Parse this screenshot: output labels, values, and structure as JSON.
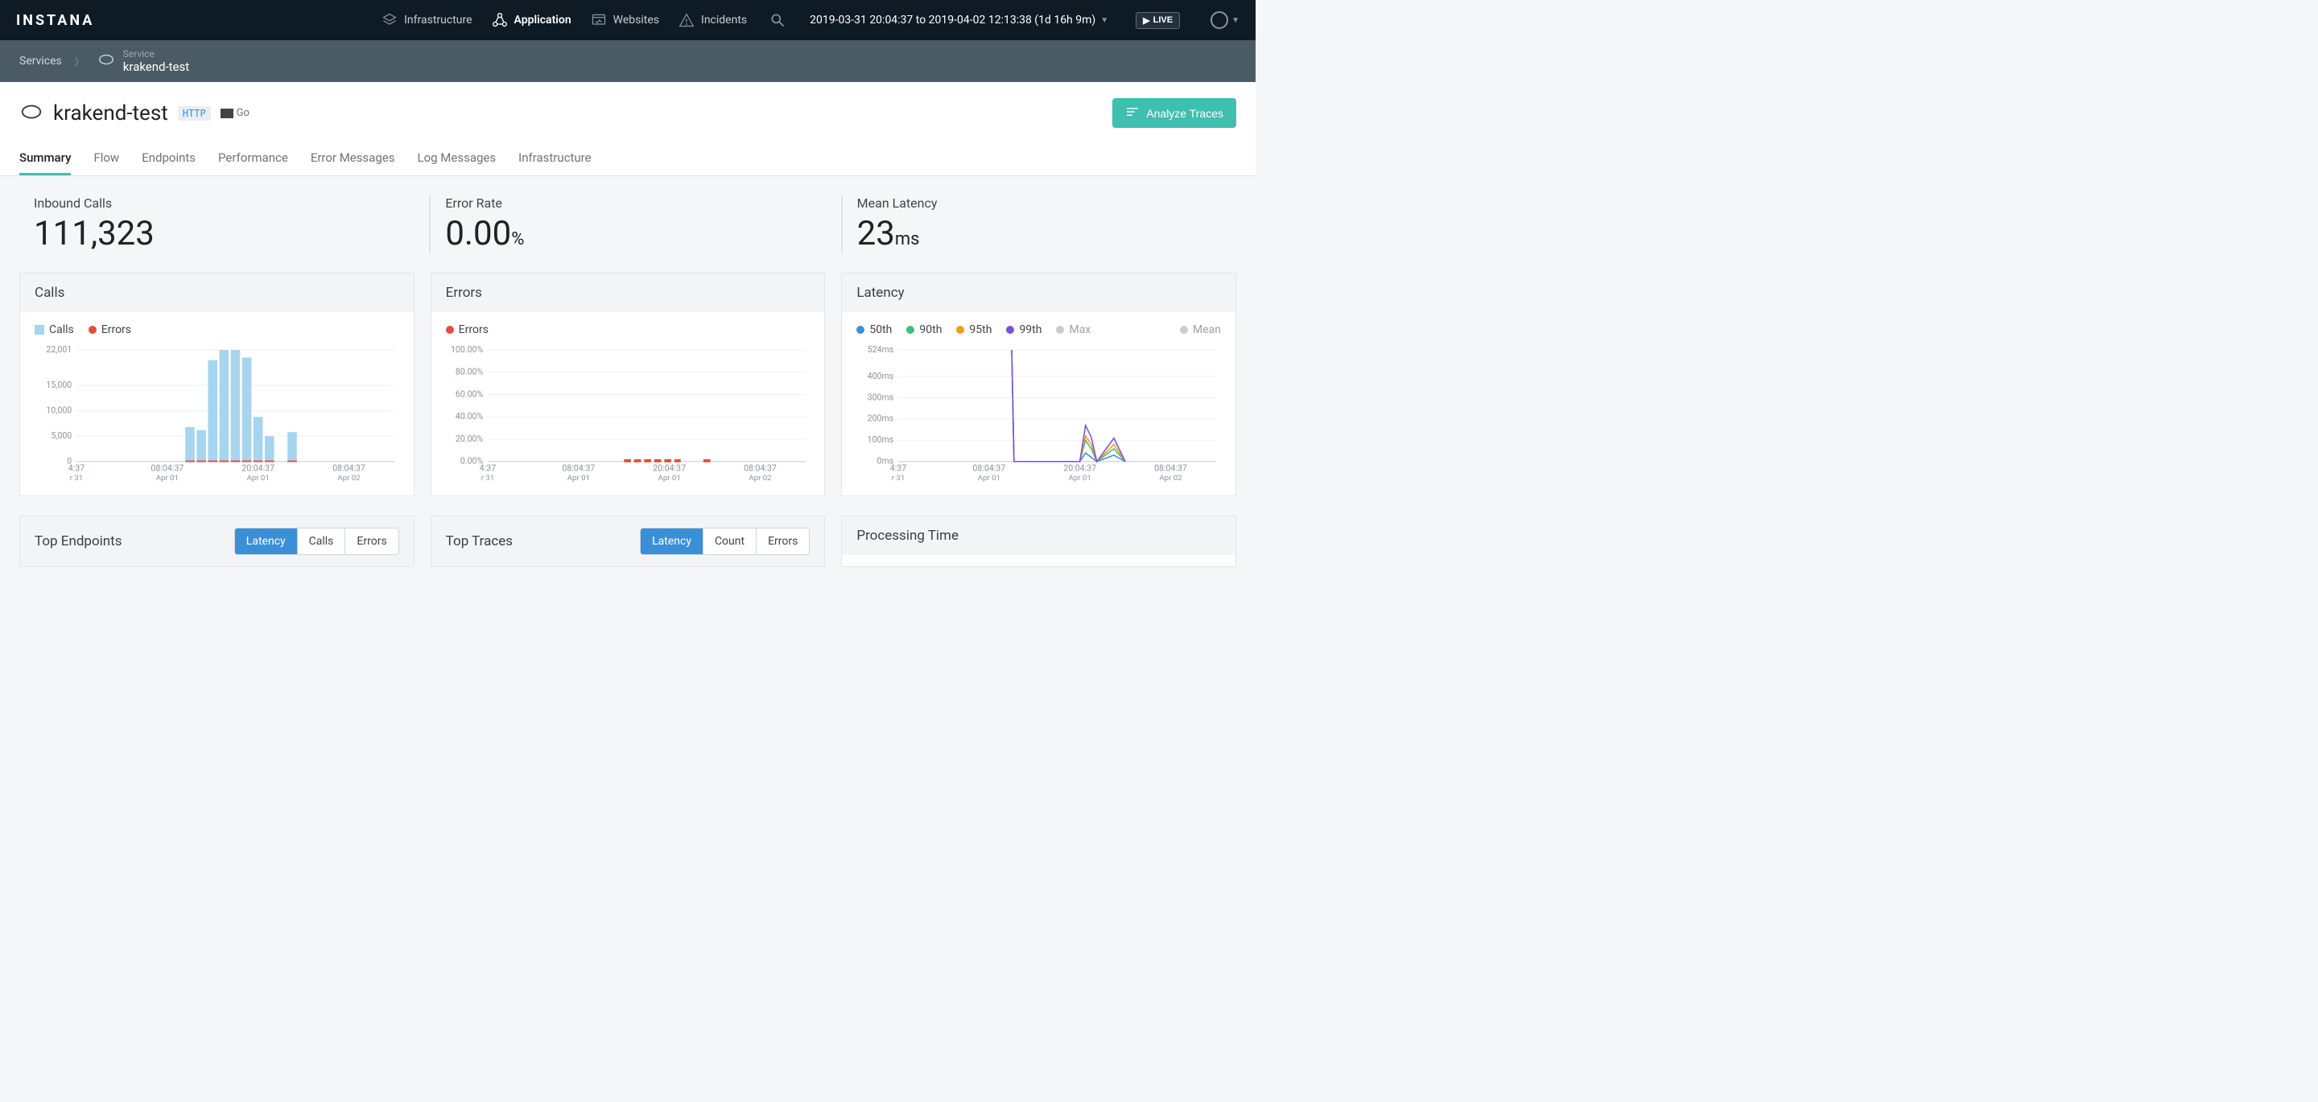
{
  "topnav": {
    "logo": "INSTANA",
    "items": [
      {
        "icon": "layers",
        "label": "Infrastructure",
        "active": false
      },
      {
        "icon": "nodes",
        "label": "Application",
        "active": true
      },
      {
        "icon": "browser",
        "label": "Websites",
        "active": false
      },
      {
        "icon": "alert",
        "label": "Incidents",
        "active": false
      }
    ],
    "timerange": "2019-03-31 20:04:37 to 2019-04-02 12:13:38 (1d 16h 9m)",
    "live_label": "LIVE"
  },
  "breadcrumb": {
    "root": "Services",
    "svc_type_label": "Service",
    "svc_name": "krakend-test"
  },
  "page": {
    "service_name": "krakend-test",
    "tag_http": "HTTP",
    "tag_lang": "Go",
    "analyze_btn": "Analyze Traces",
    "tabs": [
      "Summary",
      "Flow",
      "Endpoints",
      "Performance",
      "Error Messages",
      "Log Messages",
      "Infrastructure"
    ],
    "active_tab": 0
  },
  "kpis": [
    {
      "label": "Inbound Calls",
      "value": "111,323",
      "unit": ""
    },
    {
      "label": "Error Rate",
      "value": "0.00",
      "unit": "%"
    },
    {
      "label": "Mean Latency",
      "value": "23",
      "unit": "ms"
    }
  ],
  "panels": {
    "calls": {
      "title": "Calls",
      "legend": [
        {
          "name": "Calls",
          "color": "#a7d4ee",
          "shape": "sq"
        },
        {
          "name": "Errors",
          "color": "#e74c3c",
          "shape": "dot"
        }
      ]
    },
    "errors": {
      "title": "Errors",
      "legend": [
        {
          "name": "Errors",
          "color": "#e74c3c",
          "shape": "dot"
        }
      ]
    },
    "latency": {
      "title": "Latency",
      "legend": [
        {
          "name": "50th",
          "color": "#3b8fd6",
          "shape": "dot"
        },
        {
          "name": "90th",
          "color": "#3fbf7a",
          "shape": "dot"
        },
        {
          "name": "95th",
          "color": "#f59b1e",
          "shape": "dot"
        },
        {
          "name": "99th",
          "color": "#7a4fe0",
          "shape": "dot"
        },
        {
          "name": "Max",
          "color": "#b7bfc5",
          "shape": "dot",
          "grey": true
        },
        {
          "name": "Mean",
          "color": "#b7bfc5",
          "shape": "dot",
          "grey": true
        }
      ]
    },
    "top_endpoints": {
      "title": "Top Endpoints",
      "pills": [
        "Latency",
        "Calls",
        "Errors"
      ],
      "active_pill": 0
    },
    "top_traces": {
      "title": "Top Traces",
      "pills": [
        "Latency",
        "Count",
        "Errors"
      ],
      "active_pill": 0
    },
    "processing_time": {
      "title": "Processing Time"
    }
  },
  "chart_data": [
    {
      "id": "calls",
      "type": "bar",
      "title": "Calls",
      "xlabel": "",
      "ylabel": "",
      "ylim": [
        0,
        22001
      ],
      "y_ticks": [
        0,
        5000,
        10000,
        15000,
        22001
      ],
      "y_tick_labels": [
        "0",
        "5,000",
        "10,000",
        "15,000",
        "22,001"
      ],
      "x_tick_labels": [
        [
          "4:37",
          "r 31"
        ],
        [
          "08:04:37",
          "Apr 01"
        ],
        [
          "20:04:37",
          "Apr 01"
        ],
        [
          "08:04:37",
          "Apr 02"
        ]
      ],
      "series": [
        {
          "name": "Calls",
          "color": "#a7d4ee",
          "type": "bar",
          "x": [
            10,
            11,
            12,
            13,
            14,
            15,
            16,
            17,
            19
          ],
          "values": [
            6800,
            6200,
            20000,
            22000,
            22001,
            20500,
            8800,
            5000,
            5800
          ]
        },
        {
          "name": "Errors",
          "color": "#e74c3c",
          "type": "bar",
          "x": [
            10,
            11,
            12,
            13,
            14,
            15,
            16,
            17,
            19
          ],
          "values": [
            200,
            200,
            200,
            200,
            200,
            200,
            200,
            200,
            200
          ]
        }
      ]
    },
    {
      "id": "errors",
      "type": "line",
      "title": "Errors",
      "ylim": [
        0,
        100
      ],
      "y_ticks": [
        0,
        20,
        40,
        60,
        80,
        100
      ],
      "y_tick_labels": [
        "0.00%",
        "20.00%",
        "40.00%",
        "60.00%",
        "80.00%",
        "100.00%"
      ],
      "x_tick_labels": [
        [
          "4:37",
          "r 31"
        ],
        [
          "08:04:37",
          "Apr 01"
        ],
        [
          "20:04:37",
          "Apr 01"
        ],
        [
          "08:04:37",
          "Apr 02"
        ]
      ],
      "series": [
        {
          "name": "Errors",
          "color": "#e74c3c",
          "type": "segments",
          "segments": [
            [
              12,
              17
            ],
            [
              19,
              19.8
            ]
          ],
          "y": 0
        }
      ]
    },
    {
      "id": "latency",
      "type": "line",
      "title": "Latency",
      "ylim": [
        0,
        524
      ],
      "y_ticks": [
        0,
        100,
        200,
        300,
        400,
        524
      ],
      "y_tick_labels": [
        "0ms",
        "100ms",
        "200ms",
        "300ms",
        "400ms",
        "524ms"
      ],
      "x_tick_labels": [
        [
          "4:37",
          "r 31"
        ],
        [
          "08:04:37",
          "Apr 01"
        ],
        [
          "20:04:37",
          "Apr 01"
        ],
        [
          "08:04:37",
          "Apr 02"
        ]
      ],
      "series": [
        {
          "name": "50th",
          "color": "#3b8fd6",
          "x": [
            10,
            10.2,
            14,
            16,
            16.5,
            17,
            17.5,
            19,
            20
          ],
          "y": [
            524,
            0,
            0,
            0,
            40,
            20,
            0,
            30,
            0
          ]
        },
        {
          "name": "90th",
          "color": "#3fbf7a",
          "x": [
            10,
            10.2,
            14,
            16,
            16.5,
            17,
            17.5,
            19,
            20
          ],
          "y": [
            524,
            0,
            0,
            0,
            100,
            60,
            0,
            60,
            0
          ]
        },
        {
          "name": "95th",
          "color": "#f59b1e",
          "x": [
            10,
            10.2,
            14,
            16,
            16.5,
            17,
            17.5,
            19,
            20
          ],
          "y": [
            524,
            0,
            0,
            0,
            120,
            80,
            0,
            80,
            0
          ]
        },
        {
          "name": "99th",
          "color": "#7a4fe0",
          "x": [
            10,
            10.2,
            14,
            16,
            16.5,
            17,
            17.5,
            19,
            20
          ],
          "y": [
            524,
            0,
            0,
            0,
            170,
            115,
            0,
            110,
            0
          ]
        }
      ]
    }
  ]
}
